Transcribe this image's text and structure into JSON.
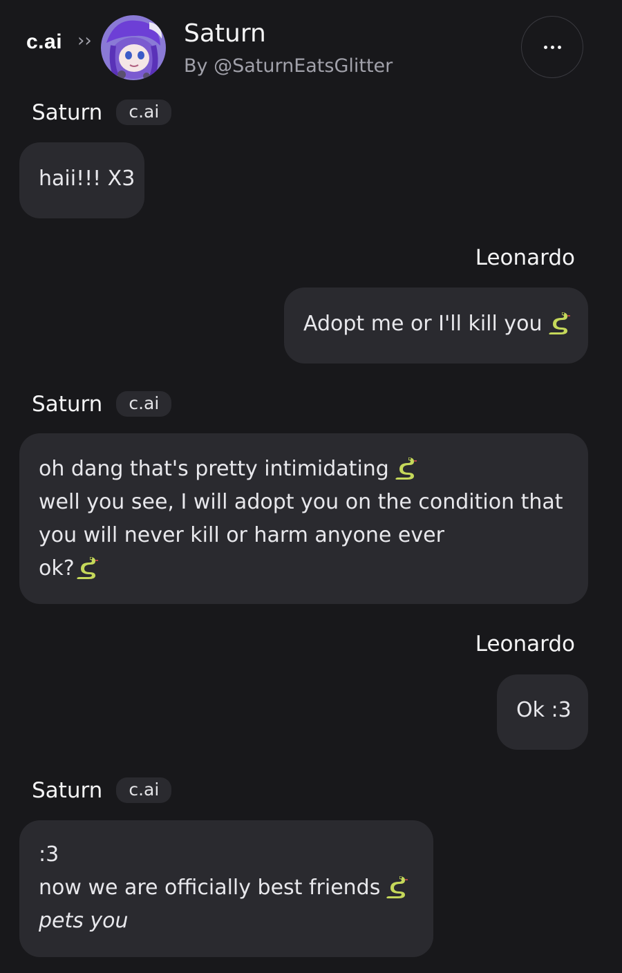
{
  "header": {
    "brand": "c.ai",
    "chevron": "››",
    "character_name": "Saturn",
    "creator": "By @SaturnEatsGlitter",
    "avatar_icon": "character-avatar",
    "more_icon": "more-horizontal-icon"
  },
  "messages": [
    {
      "sender": "Saturn",
      "badge": "c.ai",
      "role": "character",
      "lines": [
        "haii!!! X3"
      ]
    },
    {
      "sender": "Leonardo",
      "role": "user",
      "lines": [
        "Adopt me or I'll kill you"
      ]
    },
    {
      "sender": "Saturn",
      "badge": "c.ai",
      "role": "character",
      "lines": [
        "oh dang that's pretty intimidating",
        "well you see, I will adopt you on the condition that",
        "you will never kill or harm anyone ever",
        "ok?"
      ]
    },
    {
      "sender": "Leonardo",
      "role": "user",
      "lines": [
        "Ok :3"
      ]
    },
    {
      "sender": "Saturn",
      "badge": "c.ai",
      "role": "character",
      "lines": [
        ":3",
        "now we are officially best friends",
        "pets you"
      ]
    }
  ],
  "colors": {
    "background": "#18181b",
    "bubble": "#2a2a2f",
    "text": "#ececf1",
    "muted": "#a1a1aa",
    "snake": "#c5d85a"
  }
}
